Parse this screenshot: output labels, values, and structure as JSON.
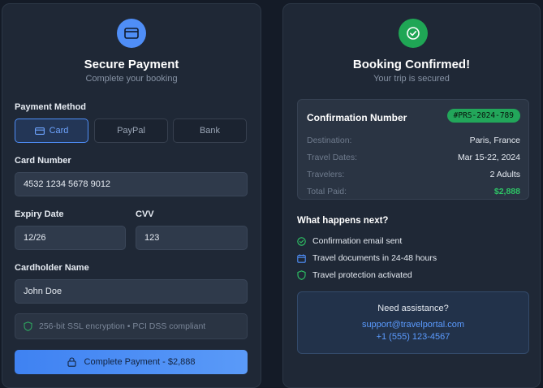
{
  "payment": {
    "title": "Secure Payment",
    "subtitle": "Complete your booking",
    "method_label": "Payment Method",
    "methods": [
      {
        "label": "Card",
        "active": true
      },
      {
        "label": "PayPal",
        "active": false
      },
      {
        "label": "Bank",
        "active": false
      }
    ],
    "card_number_label": "Card Number",
    "card_number_value": "4532 1234 5678 9012",
    "expiry_label": "Expiry Date",
    "expiry_value": "12/26",
    "cvv_label": "CVV",
    "cvv_value": "123",
    "holder_label": "Cardholder Name",
    "holder_value": "John Doe",
    "ssl_note": "256-bit SSL encryption • PCI DSS compliant",
    "pay_button": "Complete Payment - $2,888"
  },
  "confirmation": {
    "title": "Booking Confirmed!",
    "subtitle": "Your trip is secured",
    "number_label": "Confirmation Number",
    "number_value": "#PRS-2024-789",
    "rows": [
      {
        "key": "Destination:",
        "value": "Paris, France"
      },
      {
        "key": "Travel Dates:",
        "value": "Mar 15-22, 2024"
      },
      {
        "key": "Travelers:",
        "value": "2 Adults"
      },
      {
        "key": "Total Paid:",
        "value": "$2,888"
      }
    ],
    "next_title": "What happens next?",
    "next_items": [
      {
        "label": "Confirmation email sent",
        "icon": "check-circle-icon"
      },
      {
        "label": "Travel documents in 24-48 hours",
        "icon": "calendar-icon"
      },
      {
        "label": "Travel protection activated",
        "icon": "shield-icon"
      }
    ],
    "assist_title": "Need assistance?",
    "assist_email": "support@travelportal.com",
    "assist_phone": "+1 (555) 123-4567"
  },
  "colors": {
    "accent_blue": "#4f8ef7",
    "success_green": "#1fa655",
    "background": "#141b27",
    "panel": "#1f2836"
  }
}
